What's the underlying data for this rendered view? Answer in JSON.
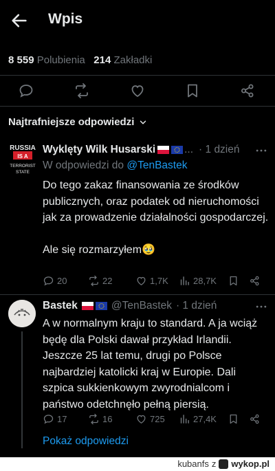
{
  "header": {
    "title": "Wpis"
  },
  "stats": {
    "likes_count": "8 559",
    "likes_label": "Polubienia",
    "bookmarks_count": "214",
    "bookmarks_label": "Zakładki"
  },
  "sort": {
    "label": "Najtrafniejsze odpowiedzi"
  },
  "replies": [
    {
      "name": "Wyklęty Wilk Husarski",
      "handle_trunc": "...",
      "time": "· 1 dzień",
      "replying_prefix": "W odpowiedzi do",
      "replying_to": "@TenBastek",
      "avatar_text": [
        "RUSSIA",
        "IS A",
        "TERRORIST",
        "STATE"
      ],
      "body": "Do tego zakaz finansowania ze środków publicznych, oraz podatek od nieruchomości jak za prowadzenie działalności gospodarczej.\n\nAle się rozmarzyłem🥹",
      "replies": "20",
      "reposts": "22",
      "likes": "1,7K",
      "views": "28,7K"
    },
    {
      "name": "Bastek",
      "handle": "@TenBastek",
      "time": "· 1 dzień",
      "body": "A w normalnym kraju to standard. A ja wciąż będę dla Polski dawał przykład Irlandii. Jeszcze 25 lat temu, drugi po Polsce najbardziej katolicki kraj w Europie. Dali szpica sukkienkowym zwyrodnialcom i państwo odetchnęło pełną piersią.",
      "replies": "17",
      "reposts": "16",
      "likes": "725",
      "views": "27,4K",
      "show_replies": "Pokaż odpowiedzi"
    }
  ],
  "footer": {
    "user": "kubanfs",
    "prefix": "z",
    "brand": "wykop.pl"
  },
  "colors": {
    "accent": "#1d9bf0",
    "muted": "#71767b",
    "text": "#e7e9ea",
    "bg": "#000000"
  }
}
